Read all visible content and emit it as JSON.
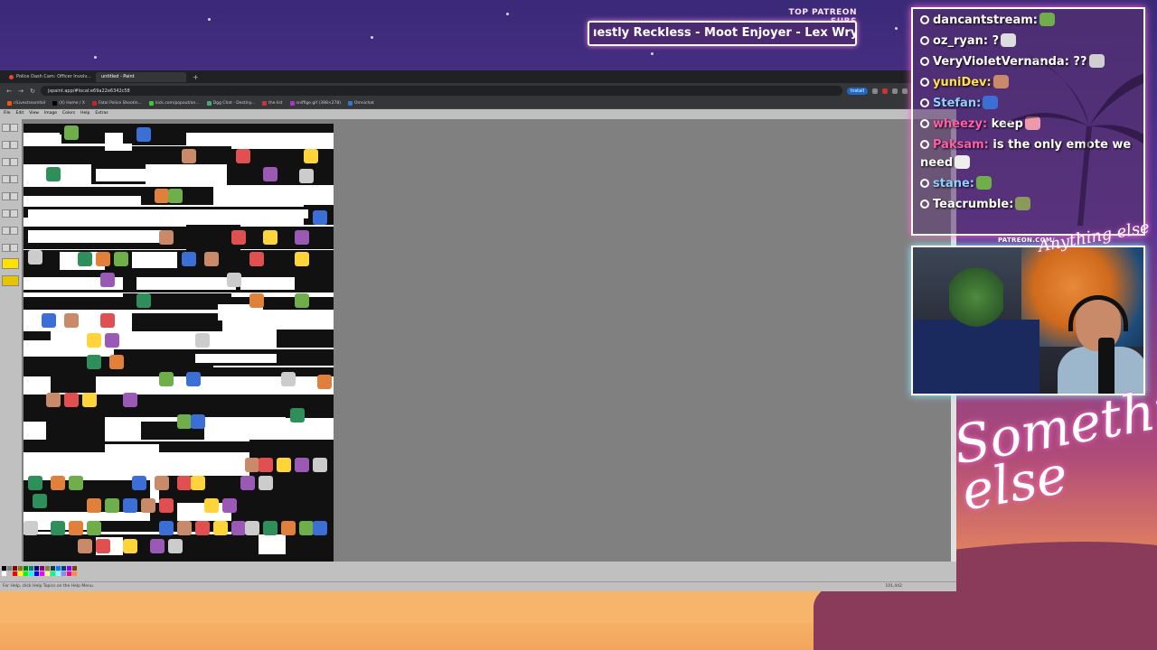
{
  "overlay": {
    "patreon_label": "TOP PATREON SUBS",
    "patreon_ticker": "ıestly Reckless - Moot Enjoyer - Lex Wrynn - N",
    "patreon_url": "PATREON.COM/",
    "logo_small": "Anything else",
    "logo_big": "Something else"
  },
  "browser": {
    "tabs": [
      {
        "label": "Police Dash Cam: Officer Involv...",
        "active": false
      },
      {
        "label": "untitled - Paint",
        "active": true
      }
    ],
    "new_tab": "+",
    "url": "jspaint.app/#local:e69a22e6342c58",
    "install_label": "Install",
    "bookmarks": [
      "r/Livestreamfail",
      "(X) Home / X",
      "Fatal Police Shootin...",
      "kick.com/popout/an...",
      "Dgg Chat - Destiny...",
      "the list",
      "sniffige.gif (398×278)",
      "Omnichat"
    ]
  },
  "paint": {
    "menu": [
      "File",
      "Edit",
      "View",
      "Image",
      "Colors",
      "Help",
      "Extras"
    ],
    "status_left": "For Help, click Help Topics on the Help Menu.",
    "status_right": "101,442"
  },
  "chat": {
    "messages": [
      {
        "user": "dancantstream",
        "color": "#ffffff",
        "text": ""
      },
      {
        "user": "oz_ryan",
        "color": "#ffffff",
        "text": "?"
      },
      {
        "user": "VeryVioletVernanda",
        "color": "#ffffff",
        "text": "??"
      },
      {
        "user": "yuniDev",
        "color": "#ffe14a",
        "text": ""
      },
      {
        "user": "Stefan",
        "color": "#8fd0ff",
        "text": ""
      },
      {
        "user": "wheezy",
        "color": "#ff5fa8",
        "text": "keep"
      },
      {
        "user": "Paksam",
        "color": "#ff5fa8",
        "text": "is the only emote we need"
      },
      {
        "user": "stane",
        "color": "#8fd0ff",
        "text": ""
      },
      {
        "user": "Teacrumble",
        "color": "#ffffff",
        "text": ""
      }
    ]
  },
  "colors": {
    "chat_border": "#ffffff",
    "chat_glow": "#ff6ad5",
    "cam_glow": "#8ef0ff",
    "paint_chrome": "#c0c0c0",
    "workspace": "#808080"
  }
}
